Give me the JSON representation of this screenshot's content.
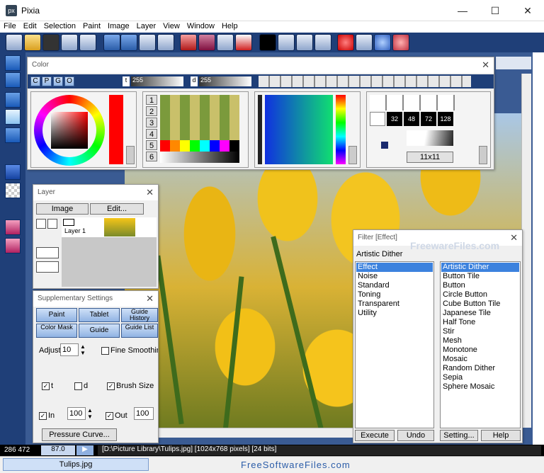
{
  "window": {
    "title": "Pixia",
    "minimize": "—",
    "maximize": "☐",
    "close": "✕"
  },
  "menu": [
    "File",
    "Edit",
    "Selection",
    "Paint",
    "Image",
    "Layer",
    "View",
    "Window",
    "Help"
  ],
  "color_panel": {
    "title": "Color",
    "tabs": [
      "C",
      "P",
      "G",
      "O"
    ],
    "t_label": "t",
    "t_value": "255",
    "d_label": "d",
    "d_value": "255",
    "palette_rows": [
      "1",
      "2",
      "3",
      "4",
      "5",
      "6"
    ],
    "brush_sizes": [
      "32",
      "48",
      "72",
      "128"
    ],
    "brush_dim": "11x11",
    "close": "✕"
  },
  "layer_panel": {
    "title": "Layer",
    "image_btn": "Image",
    "edit_btn": "Edit...",
    "layer_name": "Layer 1",
    "close": "✕"
  },
  "supp_panel": {
    "title": "Supplementary Settings",
    "buttons": [
      "Paint",
      "Tablet",
      "Guide History",
      "Color Mask",
      "Guide",
      "Guide List"
    ],
    "adjust_label": "Adjust",
    "adjust_value": "10",
    "fine_label": "Fine Smoothin",
    "t_label": "t",
    "d_label": "d",
    "brush_size_label": "Brush Size",
    "in_label": "In",
    "in_value": "100",
    "out_label": "Out",
    "out_value": "100",
    "pressure_btn": "Pressure Curve...",
    "close": "✕"
  },
  "filter_panel": {
    "title": "Filter [Effect]",
    "selected_name": "Artistic Dither",
    "categories": [
      "Effect",
      "Noise",
      "Standard",
      "Toning",
      "Transparent",
      "Utility"
    ],
    "filters": [
      "Artistic Dither",
      "Button Tile",
      "Button",
      "Circle Button",
      "Cube Button Tile",
      "Japanese Tile",
      "Half Tone",
      "Stir",
      "Mesh",
      "Monotone",
      "Mosaic",
      "Random Dither",
      "Sepia",
      "Sphere Mosaic"
    ],
    "execute": "Execute",
    "undo": "Undo",
    "setting": "Setting...",
    "help": "Help",
    "close": "✕"
  },
  "watermark": "FreewareFiles.com",
  "status": {
    "coords": "286 472",
    "zoom": "87.0",
    "file": "[D:\\Picture Library\\Tulips.jpg] [1024x768 pixels] [24 bits]"
  },
  "taskbar": {
    "tab": "Tulips.jpg",
    "site": "FreeSoftwareFiles.com"
  },
  "colors": {
    "toolbar": "#1f3f78",
    "accent": "#3c82de"
  }
}
